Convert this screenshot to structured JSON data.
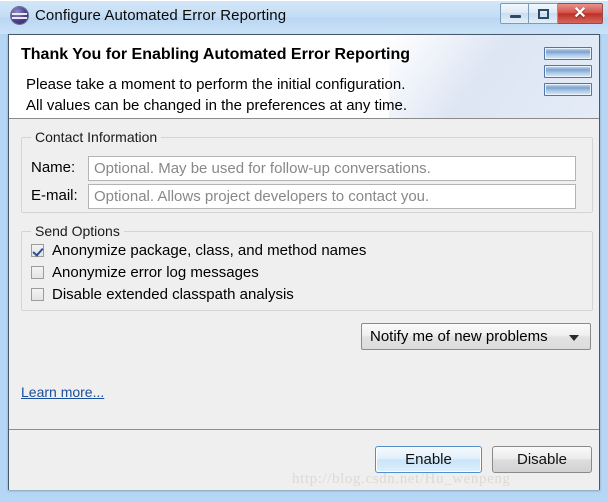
{
  "window": {
    "title": "Configure Automated Error Reporting",
    "icon": "eclipse-bugs-icon",
    "controls": {
      "minimize": "minimize-icon",
      "maximize": "maximize-icon",
      "close": "✕"
    }
  },
  "header": {
    "title": "Thank You for Enabling Automated Error Reporting",
    "line1": "Please take a moment to perform the initial configuration.",
    "line2": "All values can be changed in the preferences at any time.",
    "icon": "stacked-bars-icon"
  },
  "contact": {
    "group_title": "Contact Information",
    "fields": [
      {
        "label": "Name:",
        "value": "",
        "placeholder": "Optional. May be used for follow-up conversations."
      },
      {
        "label": "E-mail:",
        "value": "",
        "placeholder": "Optional. Allows project developers to contact you."
      }
    ]
  },
  "send_options": {
    "group_title": "Send Options",
    "items": [
      {
        "label": "Anonymize package, class, and method names",
        "checked": true
      },
      {
        "label": "Anonymize error log messages",
        "checked": false
      },
      {
        "label": "Disable extended classpath analysis",
        "checked": false
      }
    ]
  },
  "notification": {
    "selected": "Notify me of new problems",
    "options": [
      "Notify me of new problems"
    ]
  },
  "links": {
    "learn_more": "Learn more..."
  },
  "buttons": {
    "enable": "Enable",
    "disable": "Disable"
  },
  "watermark": "http://blog.csdn.net/Hu_wenpeng",
  "colors": {
    "accent": "#4f8fd0",
    "link": "#1a4f9c",
    "dialog_bg": "#efefef",
    "header_bg": "#ffffff",
    "titlebar": "#c4ddf4",
    "close_button": "#bd3127"
  }
}
